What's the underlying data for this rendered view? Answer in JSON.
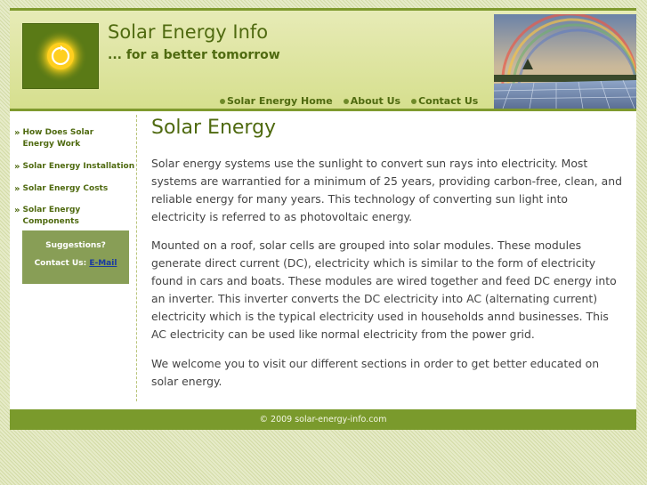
{
  "header": {
    "title": "Solar Energy Info",
    "tagline": "... for a better tomorrow",
    "logo_icon": "sun-icon",
    "photo": "rainbow-over-solar-panels-image"
  },
  "nav": [
    {
      "label": "Solar Energy Home"
    },
    {
      "label": "About Us"
    },
    {
      "label": "Contact Us"
    }
  ],
  "sidebar": {
    "links": [
      {
        "label": "How Does Solar Energy Work"
      },
      {
        "label": "Solar Energy Installation"
      },
      {
        "label": "Solar Energy Costs"
      },
      {
        "label": "Solar Energy Components"
      }
    ],
    "suggestions": {
      "title": "Suggestions?",
      "contact_label": "Contact Us:",
      "email_link": "E-Mail"
    }
  },
  "main": {
    "heading": "Solar Energy",
    "paragraphs": [
      "Solar energy systems use the sunlight to convert sun rays into electricity. Most systems are warrantied for a minimum of 25 years, providing carbon-free, clean, and reliable energy for many years. This technology of converting sun light into electricity is referred to as photovoltaic energy.",
      "Mounted on a roof, solar cells are grouped into solar modules. These modules generate direct current (DC), electricity which is similar to the form of electricity found in cars and boats. These modules are wired together and feed DC energy into an inverter. This inverter converts the DC electricity into AC (alternating current) electricity which is the typical electricity used in households annd businesses. This AC electricity can be used like normal electricity from the power grid.",
      "We welcome you to visit our different sections in order to get better educated on solar energy."
    ]
  },
  "footer": {
    "copyright": "© 2009 solar-energy-info.com"
  },
  "colors": {
    "accent": "#7a9a2c",
    "text_green": "#4f6a10",
    "body_text": "#444444"
  }
}
